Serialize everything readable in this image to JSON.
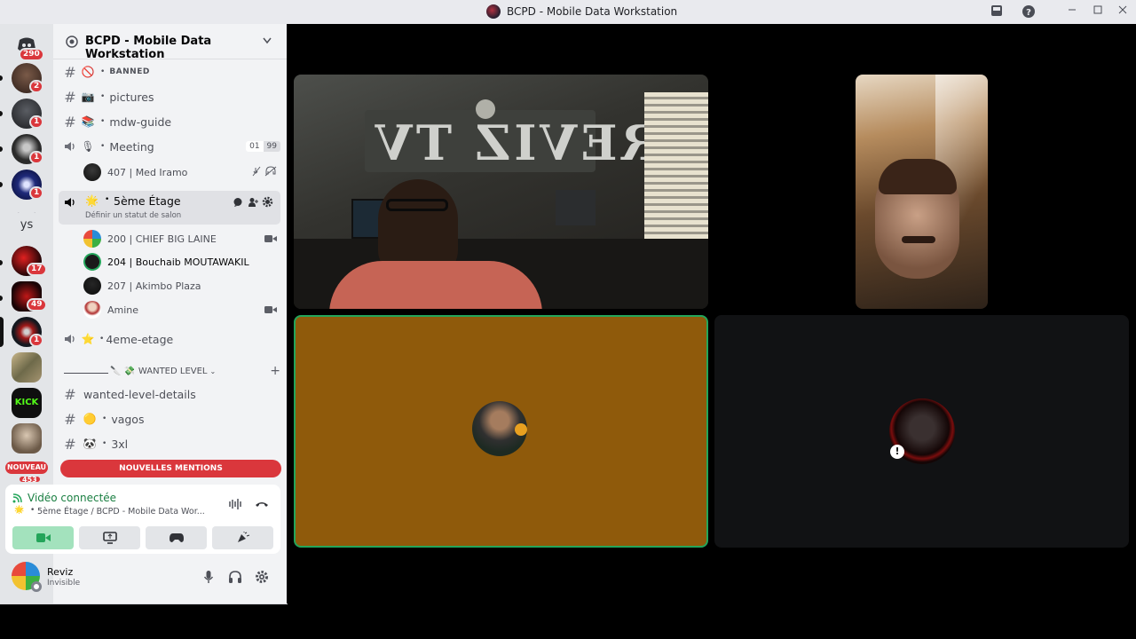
{
  "window": {
    "title": "BCPD - Mobile Data Workstation",
    "controls": [
      "inbox-icon",
      "help-icon",
      "minimize-icon",
      "maximize-icon",
      "close-icon"
    ]
  },
  "servers": {
    "dm_badge": "290",
    "items": [
      {
        "name": "server-1",
        "badge": "2"
      },
      {
        "name": "server-2",
        "badge": "1"
      },
      {
        "name": "server-3",
        "badge": "1"
      },
      {
        "name": "server-4",
        "badge": "1"
      },
      {
        "name": "server-ys",
        "label": "ys"
      },
      {
        "name": "server-5",
        "badge": "17"
      },
      {
        "name": "server-6",
        "badge": "49"
      },
      {
        "name": "server-7",
        "badge": "1"
      },
      {
        "name": "server-8"
      },
      {
        "name": "server-kick",
        "label": "KICK"
      },
      {
        "name": "server-9"
      }
    ],
    "new_label": "NOUVEAU",
    "bottom_badge": "453"
  },
  "guild": {
    "name": "BCPD - Mobile Data Workstation"
  },
  "channels": [
    {
      "type": "text",
      "emoji": "🚫",
      "name": "BANNED"
    },
    {
      "type": "text",
      "emoji": "📷",
      "name": "pictures"
    },
    {
      "type": "text",
      "emoji": "📚",
      "name": "mdw-guide"
    },
    {
      "type": "voice",
      "emoji": "🎙",
      "name": "Meeting",
      "count": "01",
      "limit": "99"
    },
    {
      "type": "voice",
      "emoji": "🌟",
      "name": "5ème Étage",
      "status": "Définir un statut de salon"
    },
    {
      "type": "voice",
      "emoji": "⭐",
      "name": "4eme-etage"
    }
  ],
  "meeting_users": [
    {
      "name": "407 | Med Iramo"
    }
  ],
  "etage_users": [
    {
      "name": "200 | CHIEF BIG LAINE"
    },
    {
      "name": "204 | Bouchaib MOUTAWAKIL"
    },
    {
      "name": "207 | Akimbo Plaza"
    },
    {
      "name": "Amine"
    }
  ],
  "category": {
    "name": "WANTED LEVEL"
  },
  "wanted_channels": [
    {
      "emoji": "",
      "name": "wanted-level-details"
    },
    {
      "emoji": "🟡",
      "name": "vagos"
    },
    {
      "emoji": "🐼",
      "name": "3xl"
    }
  ],
  "mentions_label": "NOUVELLES MENTIONS",
  "voice": {
    "status": "Vidéo connectée",
    "location": "5ème Étage / BCPD - Mobile Data Wor...",
    "buttons": [
      "camera-icon",
      "screen-share-icon",
      "activity-icon",
      "soundboard-icon"
    ]
  },
  "me": {
    "name": "Reviz",
    "status": "Invisible"
  },
  "colors": {
    "accent_green": "#23a55a",
    "mention_red": "#da373c",
    "tile_orange": "#8f5a0b"
  },
  "video": {
    "wall_text": "REVIZ TV"
  }
}
